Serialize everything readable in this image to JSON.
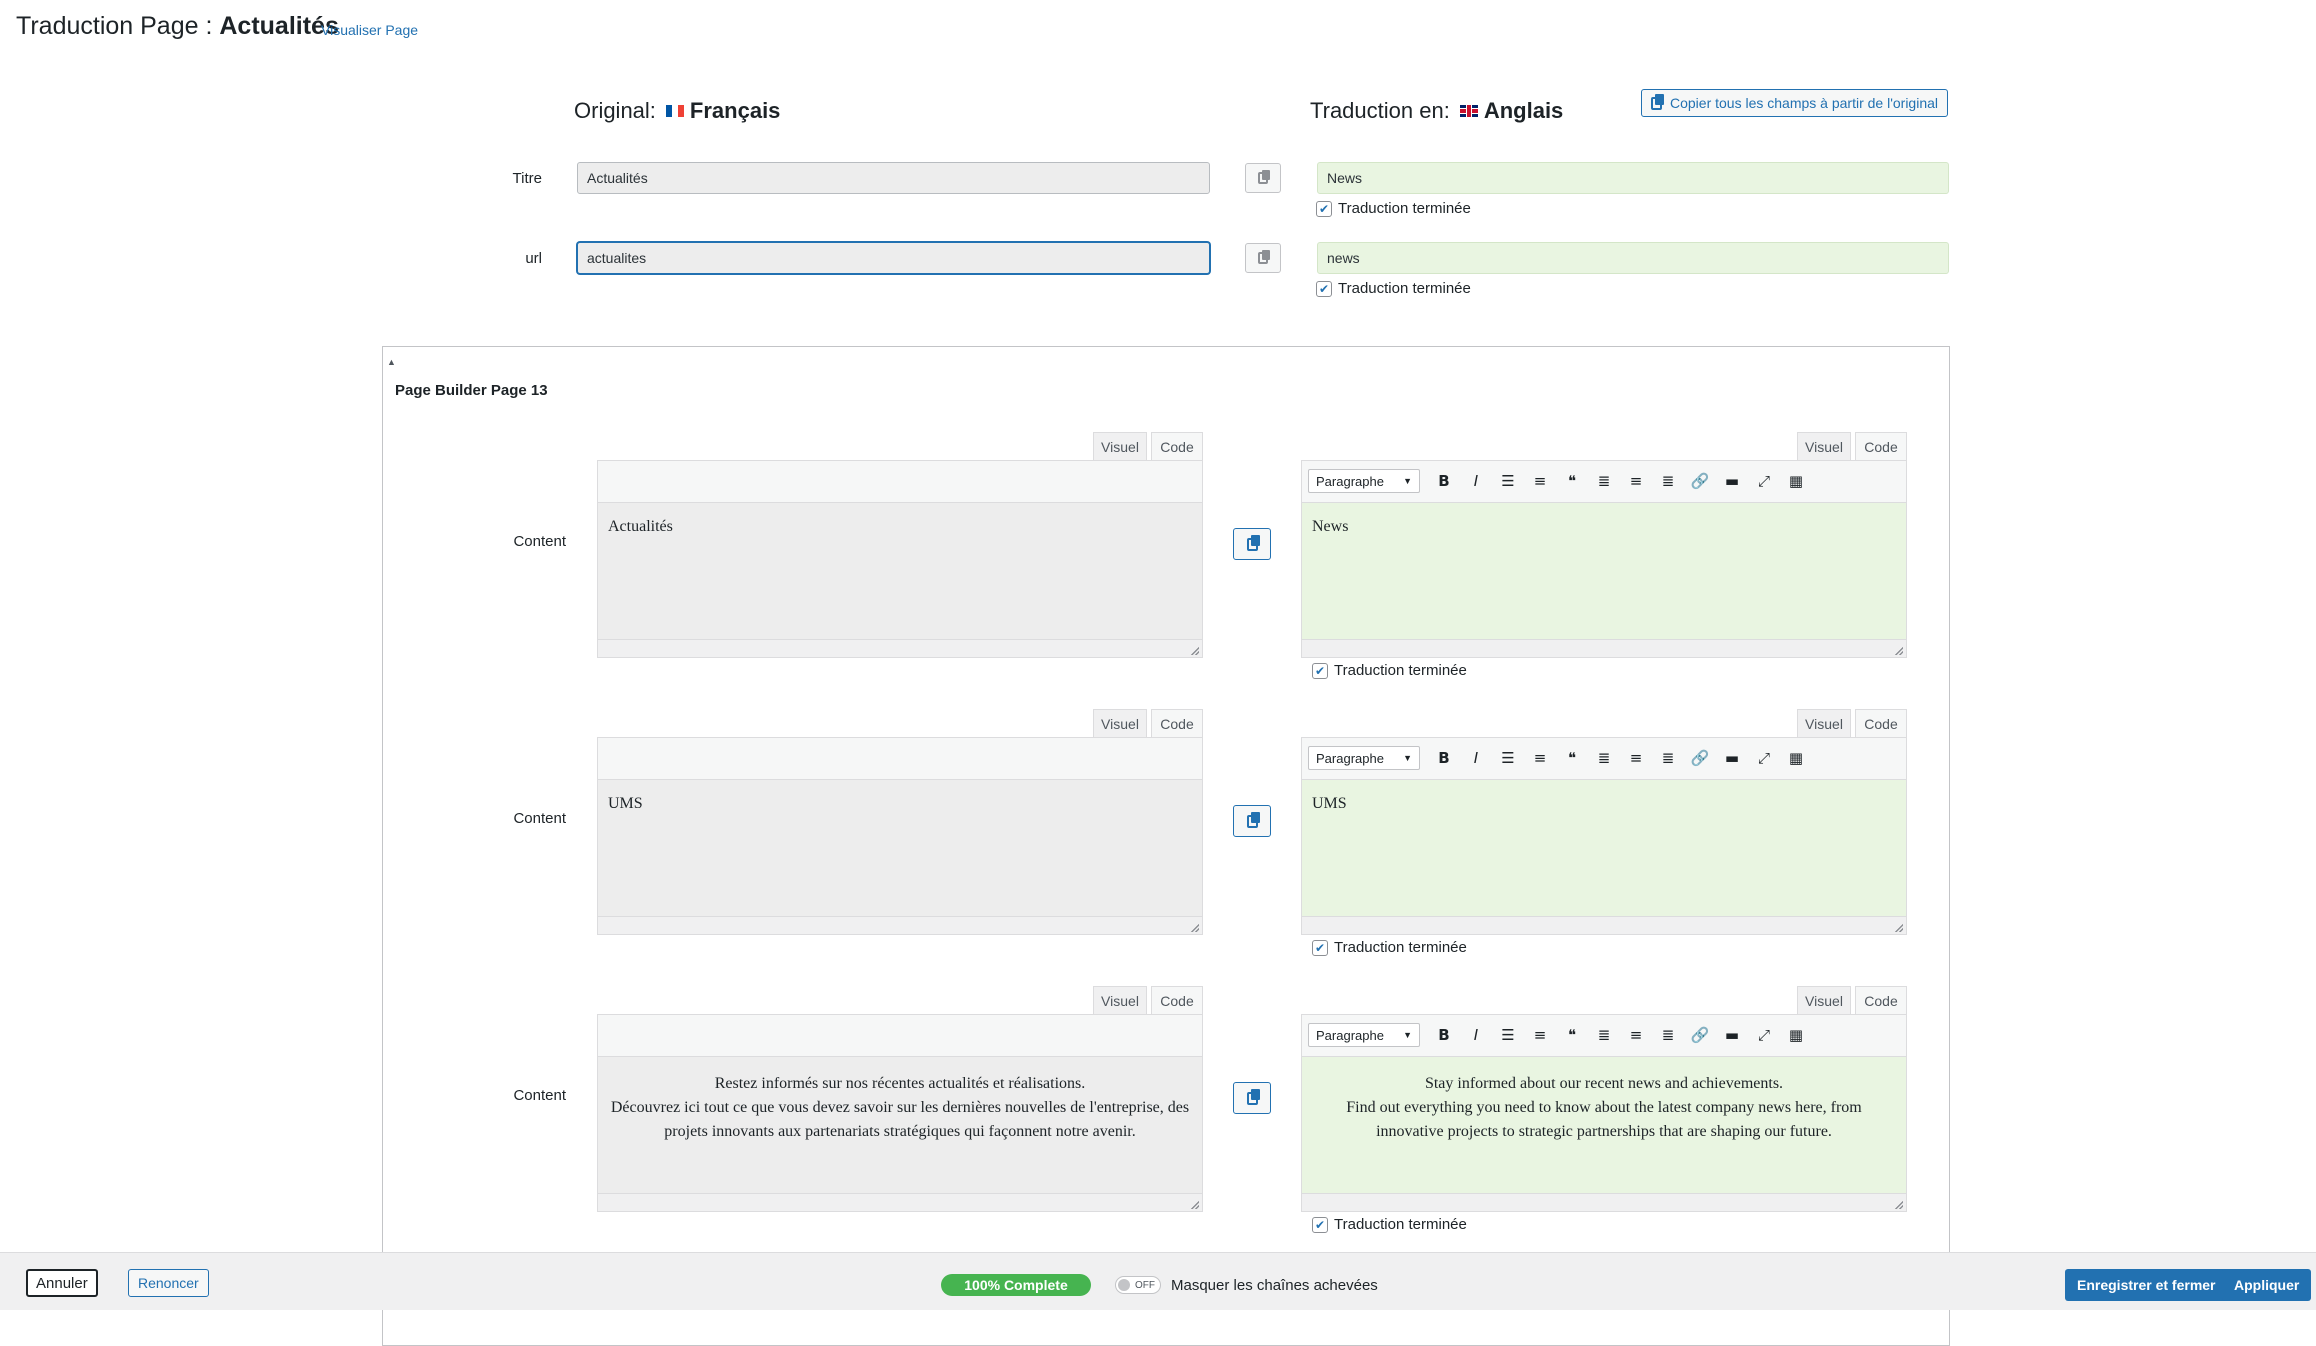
{
  "header": {
    "title_prefix": "Traduction Page : ",
    "title_page": "Actualités",
    "view_link": "Visualiser Page"
  },
  "languages": {
    "original_label": "Original:",
    "original_name": "Français",
    "target_label": "Traduction en:",
    "target_name": "Anglais",
    "copy_all_label": "Copier tous les champs à partir de l'original"
  },
  "fields": [
    {
      "label": "Titre",
      "original": "Actualités",
      "translation": "News",
      "done_label": "Traduction terminée"
    },
    {
      "label": "url",
      "original": "actualites",
      "translation": "news",
      "done_label": "Traduction terminée"
    }
  ],
  "page_builder": {
    "title": "Page Builder Page 13",
    "toggle_glyph": "▲",
    "tab_visual": "Visuel",
    "tab_code": "Code",
    "format_select": "Paragraphe",
    "done_label": "Traduction terminée",
    "toolbar_icons": [
      "bold-icon",
      "italic-icon",
      "bullet-list-icon",
      "numbered-list-icon",
      "blockquote-icon",
      "align-left-icon",
      "align-center-icon",
      "align-right-icon",
      "link-icon",
      "horizontal-rule-icon",
      "fullscreen-icon",
      "toolbar-toggle-icon"
    ],
    "content_blocks": [
      {
        "label": "Content",
        "original": [
          "Actualités"
        ],
        "translation": [
          "News"
        ],
        "centered": false
      },
      {
        "label": "Content",
        "original": [
          "UMS"
        ],
        "translation": [
          "UMS"
        ],
        "centered": false
      },
      {
        "label": "Content",
        "original": [
          "Restez informés sur nos récentes actualités et réalisations.",
          "Découvrez ici tout ce que vous devez savoir sur les dernières nouvelles de l'entreprise, des projets innovants aux partenariats stratégiques qui façonnent notre avenir."
        ],
        "translation": [
          "Stay informed about our recent news and achievements.",
          "Find out everything you need to know about the latest company news here, from innovative projects to strategic partnerships that are shaping our future."
        ],
        "centered": true
      }
    ]
  },
  "footer": {
    "cancel_label": "Annuler",
    "resign_label": "Renoncer",
    "progress_label": "100% Complete",
    "progress_value": 1.0,
    "toggle_state": "OFF",
    "toggle_label": "Masquer les chaînes achevées",
    "save_close_label": "Enregistrer et fermer",
    "apply_label": "Appliquer"
  },
  "colors": {
    "accent": "#2271b1",
    "translation_bg": "#e9f5e1",
    "original_bg": "#ededed",
    "progress": "#46b450"
  }
}
